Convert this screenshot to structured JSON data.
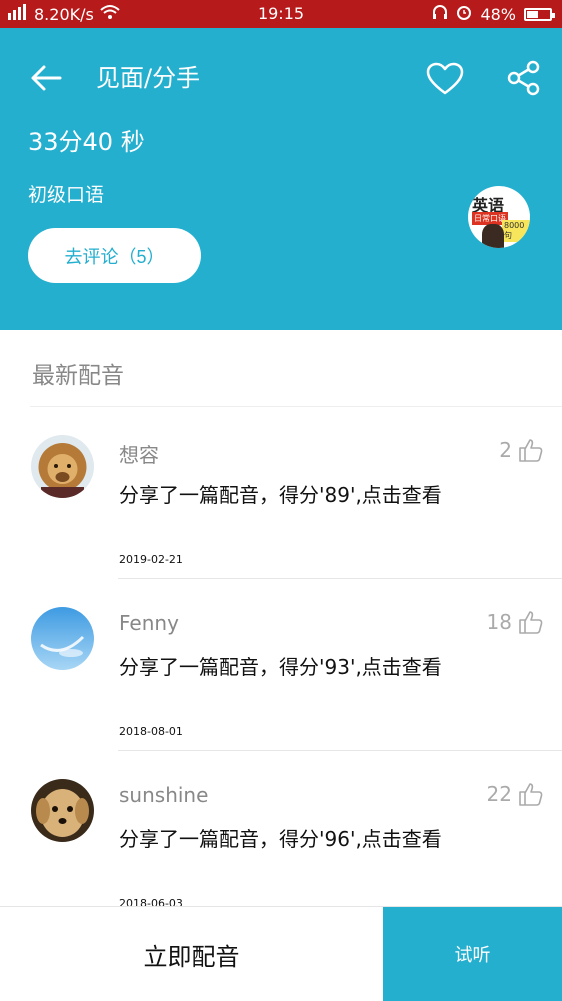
{
  "status_bar": {
    "network": "8.20K/s",
    "time": "19:15",
    "battery": "48%",
    "battery_level": 0.48
  },
  "header": {
    "title": "见面/分手",
    "duration": "33分40 秒",
    "level": "初级口语",
    "comment_button": "去评论（5）",
    "course_badge": {
      "line1": "英语",
      "line2": "日常口语",
      "line3": "8000句"
    }
  },
  "section": {
    "title": "最新配音"
  },
  "dubs": [
    {
      "user": "想容",
      "likes": "2",
      "text": "分享了一篇配音，得分'89',点击查看",
      "date": "2019-02-21",
      "avatar": "lion"
    },
    {
      "user": "Fenny",
      "likes": "18",
      "text": "分享了一篇配音，得分'93',点击查看",
      "date": "2018-08-01",
      "avatar": "sky"
    },
    {
      "user": "sunshine",
      "likes": "22",
      "text": "分享了一篇配音，得分'96',点击查看",
      "date": "2018-06-03",
      "avatar": "puppy"
    }
  ],
  "bottom": {
    "dub_now": "立即配音",
    "listen": "试听"
  },
  "colors": {
    "primary": "#24afcf",
    "statusbar": "#b71a1a"
  }
}
